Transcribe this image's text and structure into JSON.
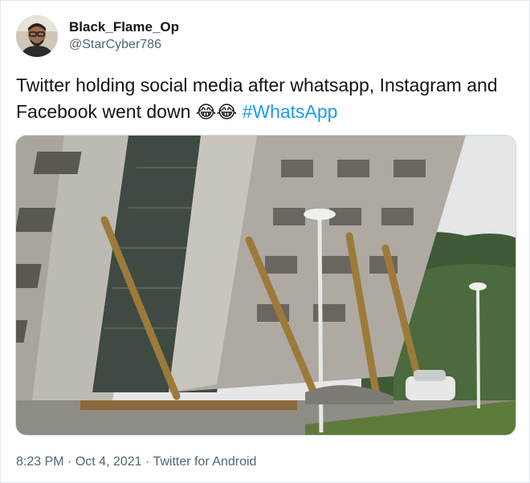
{
  "user": {
    "display_name": "Black_Flame_Op",
    "handle": "@StarCyber786"
  },
  "tweet": {
    "text": "Twitter holding social media after whatsapp, Instagram and Facebook went down",
    "emojis": "😂😂",
    "hashtag": "#WhatsApp"
  },
  "meta": {
    "time": "8:23 PM",
    "separator": "·",
    "date": "Oct 4, 2021",
    "source": "Twitter for Android"
  },
  "colors": {
    "link": "#1d9bf0",
    "secondary_text": "#536471",
    "border": "#cfd9de"
  }
}
